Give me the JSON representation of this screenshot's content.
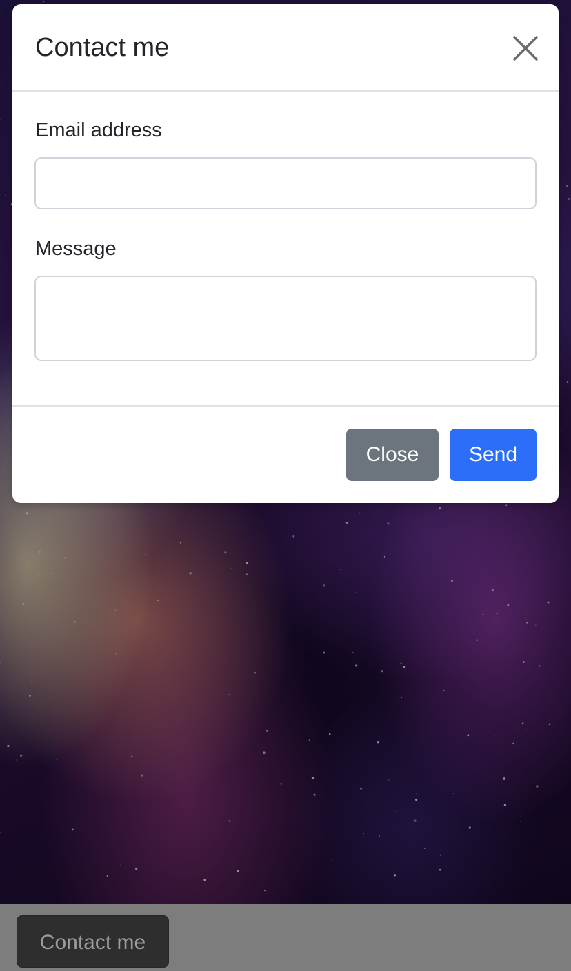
{
  "modal": {
    "title": "Contact me",
    "close_icon": "close-x-icon",
    "email_label": "Email address",
    "email_value": "",
    "message_label": "Message",
    "message_value": "",
    "close_button": "Close",
    "send_button": "Send"
  },
  "page": {
    "contact_button": "Contact me"
  },
  "colors": {
    "primary": "#2d6ef9",
    "secondary": "#6c757d",
    "bottom_bar": "#7d7d7d",
    "dark_button": "#2e2e2e"
  }
}
